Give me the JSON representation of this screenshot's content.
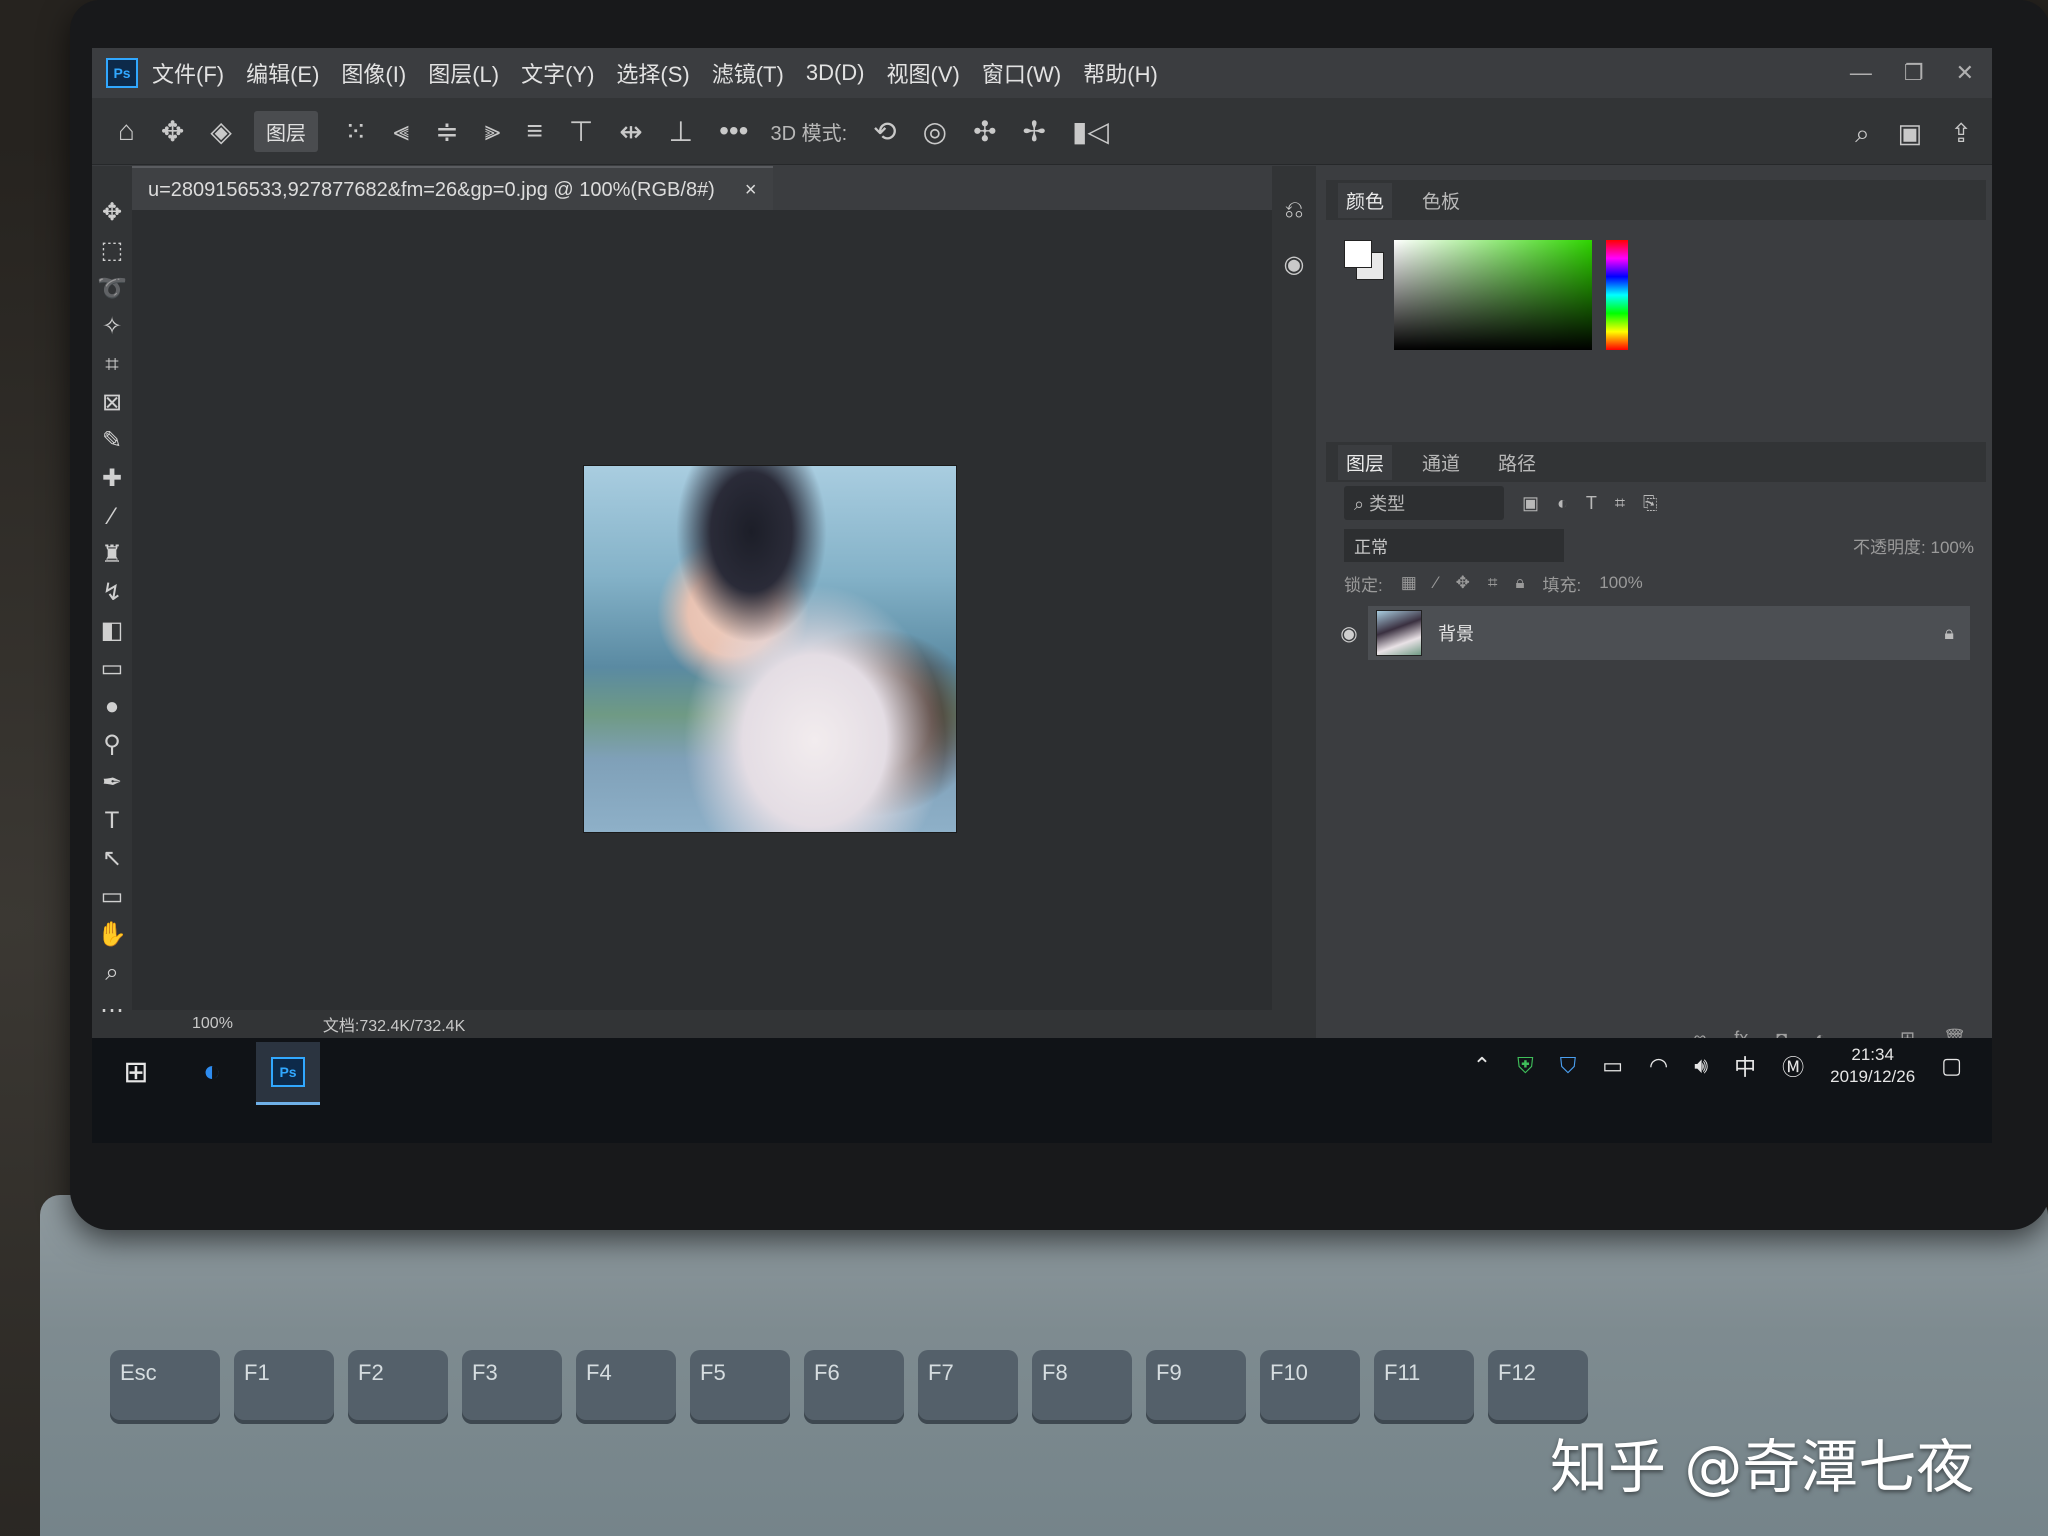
{
  "menubar": {
    "items": [
      "文件(F)",
      "编辑(E)",
      "图像(I)",
      "图层(L)",
      "文字(Y)",
      "选择(S)",
      "滤镜(T)",
      "3D(D)",
      "视图(V)",
      "窗口(W)",
      "帮助(H)"
    ]
  },
  "options_bar": {
    "layer_select": "图层",
    "mode_label": "3D 模式:"
  },
  "document": {
    "tab_title": "u=2809156533,927877682&fm=26&gp=0.jpg @ 100%(RGB/8#)",
    "tab_close": "×",
    "zoom": "100%",
    "doc_info": "文档:732.4K/732.4K"
  },
  "color_panel": {
    "tabs": [
      "颜色",
      "色板"
    ]
  },
  "layers_panel": {
    "tabs": [
      "图层",
      "通道",
      "路径"
    ],
    "filter_kind": "类型",
    "blend_mode": "正常",
    "opacity_label": "不透明度:",
    "opacity_value": "100%",
    "lock_label": "锁定:",
    "fill_label": "填充:",
    "fill_value": "100%",
    "layer_name": "背景"
  },
  "taskbar": {
    "time": "21:34",
    "date": "2019/12/26",
    "ime": "中"
  },
  "keyboard": {
    "keys": [
      "Esc",
      "F1",
      "F2",
      "F3",
      "F4",
      "F5",
      "F6",
      "F7",
      "F8",
      "F9",
      "F10",
      "F11",
      "F12"
    ]
  },
  "watermark": "知乎 @奇潭七夜"
}
